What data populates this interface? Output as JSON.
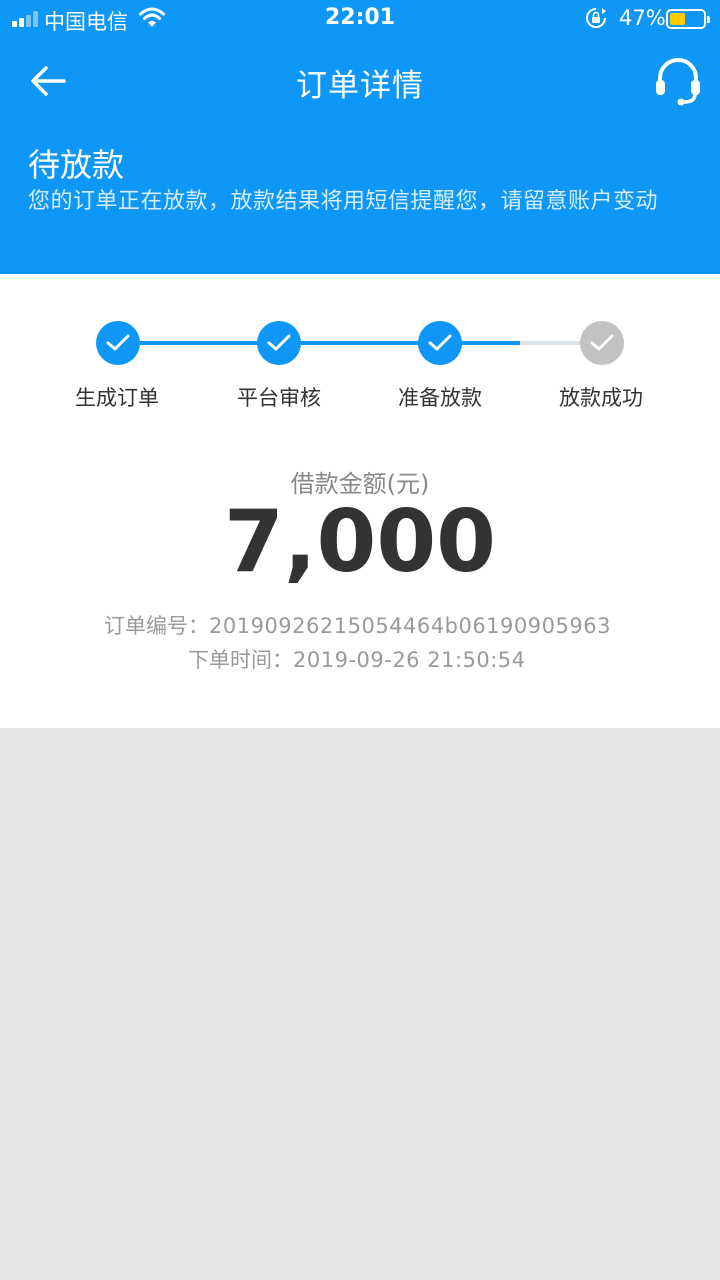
{
  "status_bar": {
    "carrier": "中国电信",
    "time": "22:01",
    "battery_percent": "47%",
    "battery_level": 0.47,
    "battery_color": "#ffcc00"
  },
  "nav": {
    "title": "订单详情",
    "back_icon": "arrow-left-icon",
    "service_icon": "headset-icon"
  },
  "order_status": {
    "title": "待放款",
    "description": "您的订单正在放款，放款结果将用短信提醒您，请留意账户变动"
  },
  "steps": [
    {
      "label": "生成订单",
      "done": true
    },
    {
      "label": "平台审核",
      "done": true
    },
    {
      "label": "准备放款",
      "done": true
    },
    {
      "label": "放款成功",
      "done": false
    }
  ],
  "loan": {
    "amount_label": "借款金额(元)",
    "amount": "7,000"
  },
  "order_info": {
    "number_label": "订单编号：",
    "number_value": "2019092621505446​4b06190905963",
    "time_label": "下单时间：",
    "time_value": "2019-09-26 21:50:54"
  },
  "colors": {
    "primary": "#0e97f6",
    "pending": "#c2c2c2",
    "background": "#e6e6e6"
  }
}
